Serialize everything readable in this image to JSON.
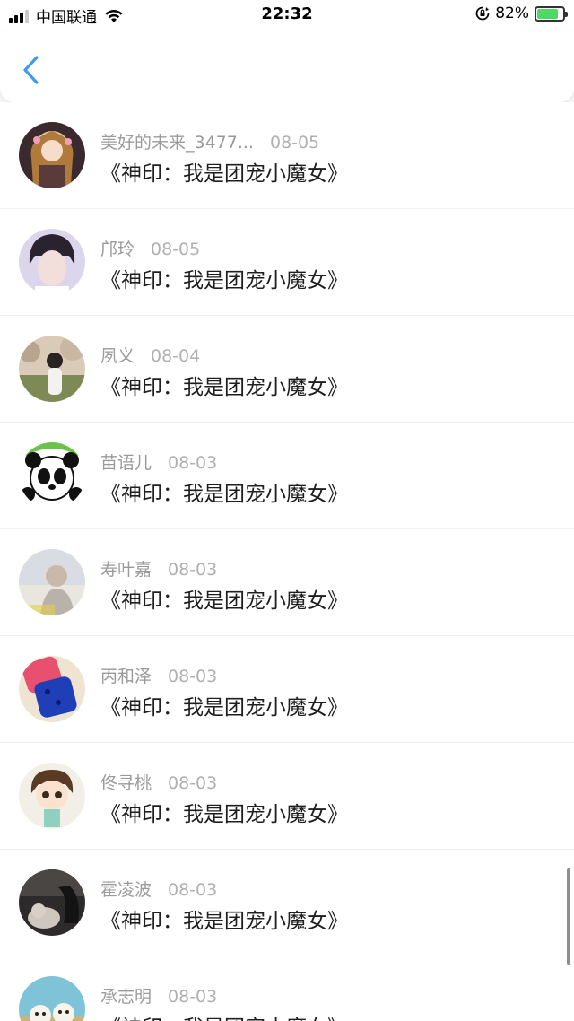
{
  "status_bar": {
    "carrier": "中国联通",
    "time": "22:32",
    "battery_percent": "82%",
    "battery_level": 0.82,
    "signal_icon": "signal-bars-icon",
    "wifi_icon": "wifi-icon",
    "rotation_lock_icon": "rotation-lock-icon",
    "battery_icon": "battery-charging-icon"
  },
  "header": {
    "back_icon": "chevron-left-icon",
    "accent_color": "#3d9bef"
  },
  "list": {
    "items": [
      {
        "name": "美好的未来_3477...",
        "date": "08-05",
        "book": "《神印：我是团宠小魔女》",
        "avatar_icon": "anime-girl-avatar"
      },
      {
        "name": "邝玲",
        "date": "08-05",
        "book": "《神印：我是团宠小魔女》",
        "avatar_icon": "boy-portrait-avatar"
      },
      {
        "name": "夙义",
        "date": "08-04",
        "book": "《神印：我是团宠小魔女》",
        "avatar_icon": "girl-outdoor-avatar"
      },
      {
        "name": "苗语儿",
        "date": "08-03",
        "book": "《神印：我是团宠小魔女》",
        "avatar_icon": "panda-avatar"
      },
      {
        "name": "寿叶嘉",
        "date": "08-03",
        "book": "《神印：我是团宠小魔女》",
        "avatar_icon": "faded-portrait-avatar"
      },
      {
        "name": "丙和泽",
        "date": "08-03",
        "book": "《神印：我是团宠小魔女》",
        "avatar_icon": "phone-case-avatar"
      },
      {
        "name": "佟寻桃",
        "date": "08-03",
        "book": "《神印：我是团宠小魔女》",
        "avatar_icon": "cartoon-boy-avatar"
      },
      {
        "name": "霍凌波",
        "date": "08-03",
        "book": "《神印：我是团宠小魔女》",
        "avatar_icon": "dark-cat-avatar"
      },
      {
        "name": "承志明",
        "date": "08-03",
        "book": "《神印：我是团宠小魔女》",
        "avatar_icon": "cartoon-cats-avatar"
      }
    ]
  }
}
